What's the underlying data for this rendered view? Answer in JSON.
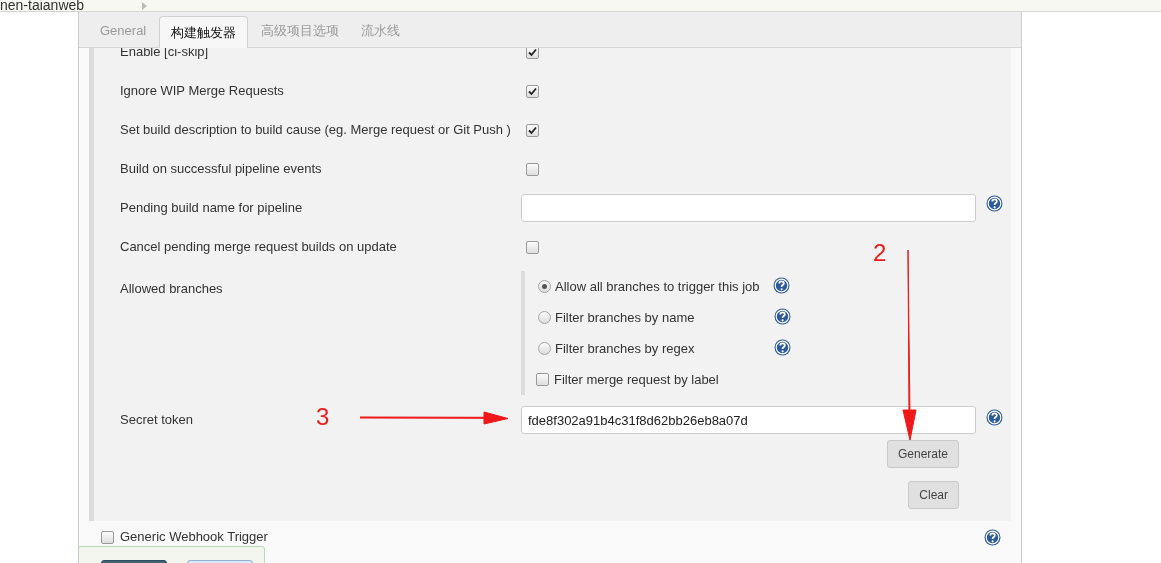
{
  "breadcrumb": "nen-taianweb",
  "tabs": [
    {
      "label": "General",
      "selected": false
    },
    {
      "label": "构建触发器",
      "selected": true
    },
    {
      "label": "高级项目选项",
      "selected": false
    },
    {
      "label": "流水线",
      "selected": false
    }
  ],
  "settings": [
    {
      "kind": "checkbox",
      "label": "Enable [ci-skip]",
      "checked": true
    },
    {
      "kind": "checkbox",
      "label": "Ignore WIP Merge Requests",
      "checked": true
    },
    {
      "kind": "checkbox",
      "label": "Set build description to build cause (eg. Merge request or Git Push )",
      "checked": true
    },
    {
      "kind": "checkbox",
      "label": "Build on successful pipeline events",
      "checked": false
    },
    {
      "kind": "text",
      "label": "Pending build name for pipeline",
      "help": true
    },
    {
      "kind": "checkbox",
      "label": "Cancel pending merge request builds on update",
      "checked": false
    },
    {
      "kind": "choices",
      "label": "Allowed branches",
      "choices": [
        {
          "kind": "radio",
          "label": "Allow all branches to trigger this job",
          "selected": true,
          "help": true
        },
        {
          "kind": "radio",
          "label": "Filter branches by name",
          "selected": false,
          "help": true
        },
        {
          "kind": "radio",
          "label": "Filter branches by regex",
          "selected": false,
          "help": true
        },
        {
          "kind": "checkbox",
          "label": "Filter merge request by label",
          "checked": false
        }
      ]
    },
    {
      "kind": "token",
      "label": "Secret token",
      "value": "fde8f302a91b4c31f8d62bb26eb8a07d",
      "help": true,
      "buttons": [
        "Generate",
        "Clear"
      ]
    }
  ],
  "triggers": [
    {
      "label": "Generic Webhook Trigger",
      "checked": false,
      "help": true
    }
  ],
  "annotations": [
    {
      "kind": "down",
      "label": "2"
    },
    {
      "kind": "right",
      "label": "3"
    }
  ],
  "bottom_bar": {
    "buttons": [
      {
        "kind": "primary"
      },
      {
        "kind": "secondary"
      }
    ]
  }
}
